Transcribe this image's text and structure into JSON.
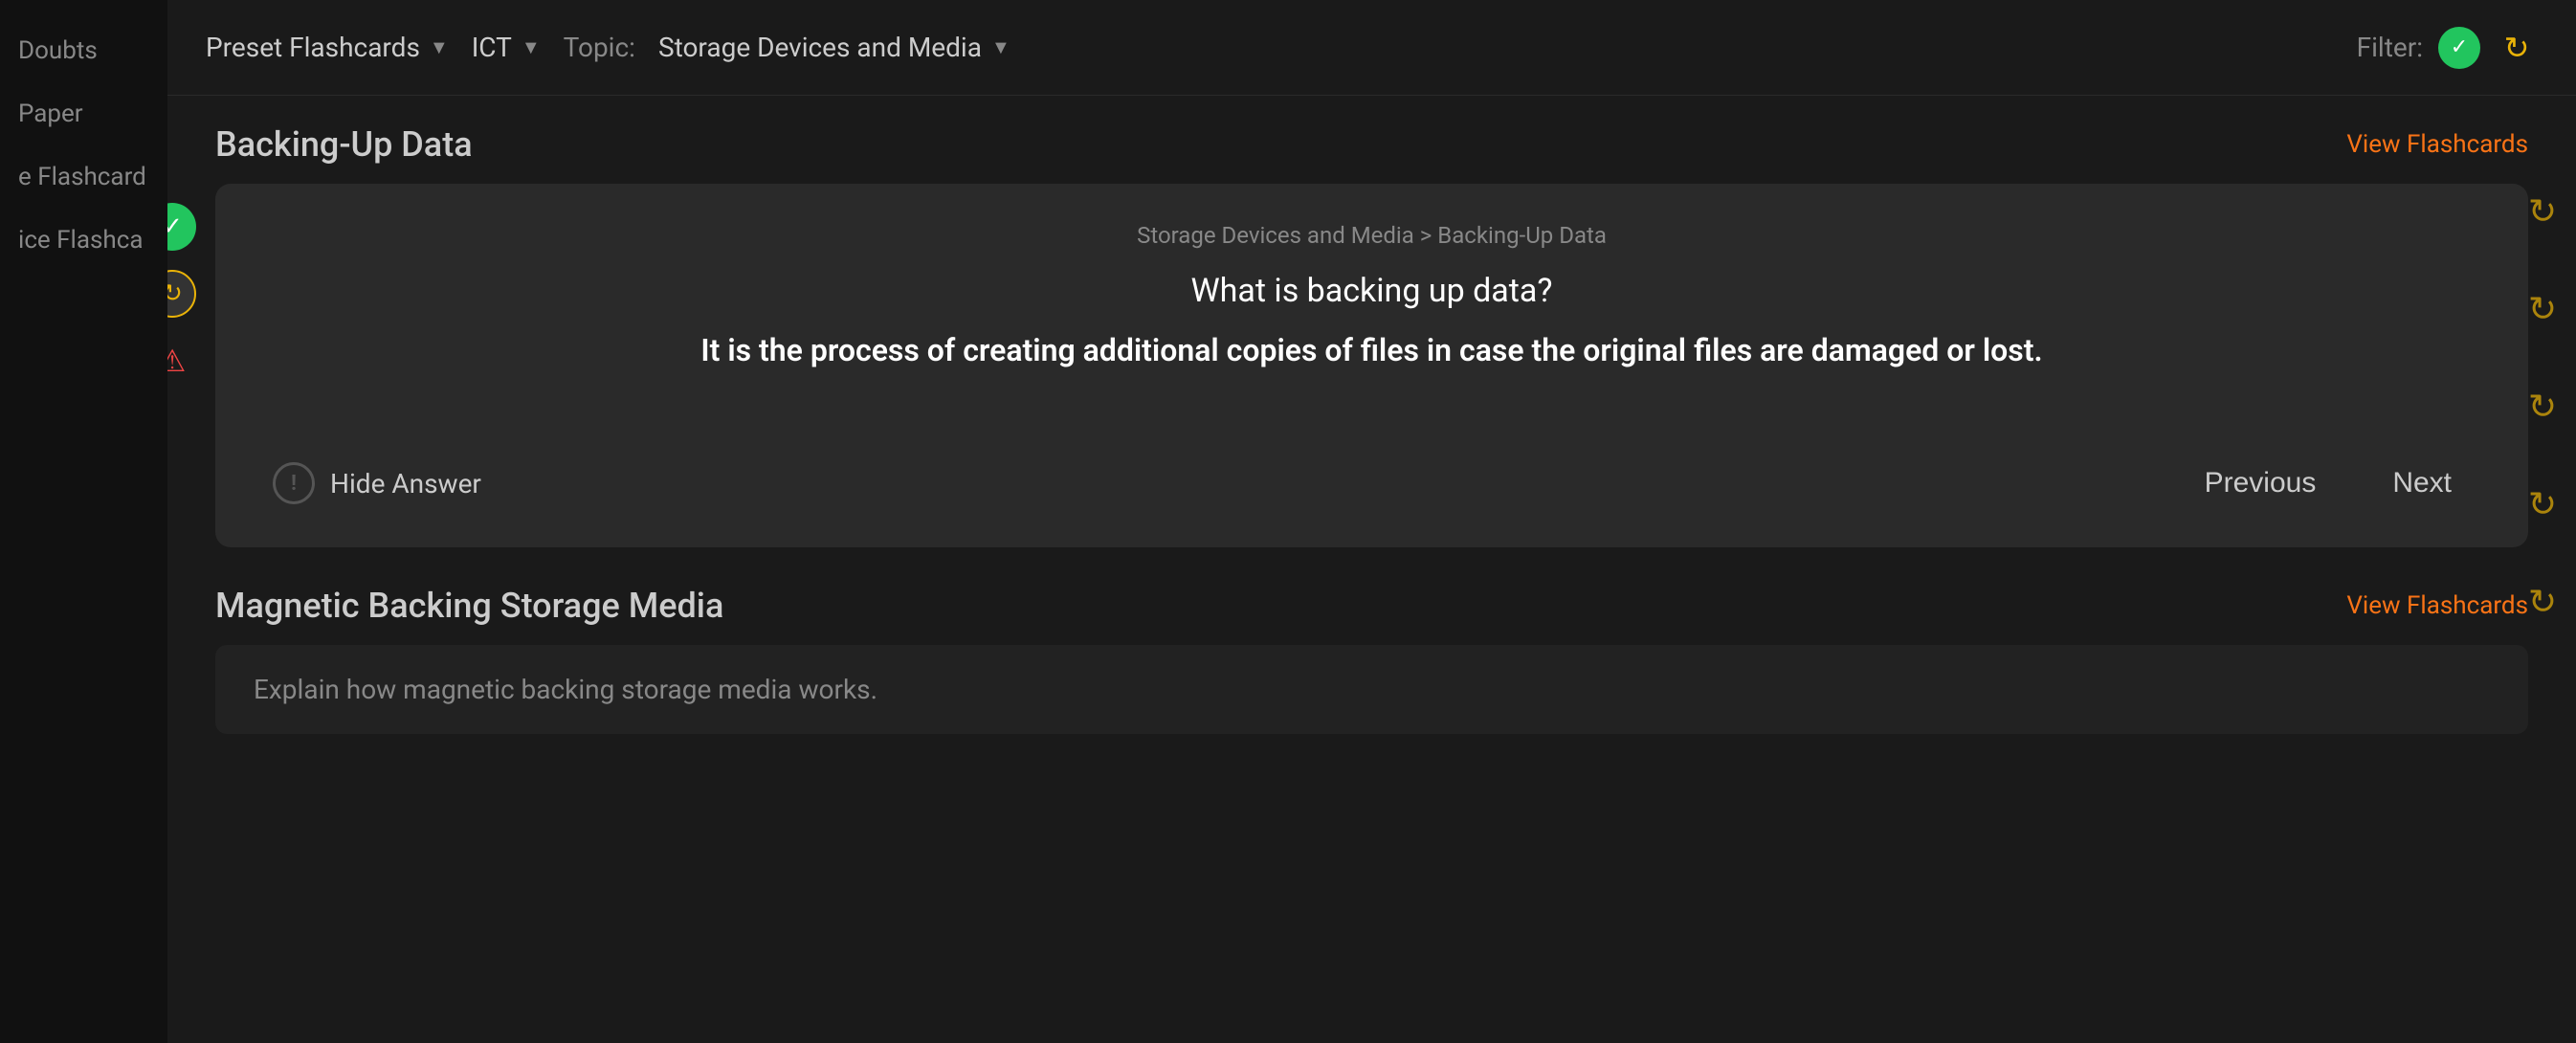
{
  "sidebar": {
    "items": [
      {
        "label": "Doubts",
        "id": "doubts"
      },
      {
        "label": "Paper",
        "id": "paper"
      },
      {
        "label": "e Flashcard",
        "id": "e-flashcard"
      },
      {
        "label": "ice Flashca",
        "id": "practice-flashcard"
      }
    ]
  },
  "topbar": {
    "preset_flashcards_label": "Preset Flashcards",
    "ict_label": "ICT",
    "topic_label": "Topic:",
    "storage_devices_label": "Storage Devices and Media",
    "filter_label": "Filter:",
    "arrow_icon": "▼"
  },
  "section1": {
    "title": "Backing-Up Data",
    "view_flashcards": "View Flashcards"
  },
  "flashcard": {
    "breadcrumb": "Storage Devices and Media > Backing-Up Data",
    "question": "What is backing up data?",
    "answer": "It is the process of creating additional copies of files in case the original files are damaged or lost.",
    "hide_answer_label": "Hide Answer",
    "previous_label": "Previous",
    "next_label": "Next"
  },
  "section2": {
    "title": "Magnetic Backing Storage Media",
    "view_flashcards": "View Flashcards",
    "card_text": "Explain how magnetic backing storage media works."
  },
  "icons": {
    "green_check": "✓",
    "yellow_refresh": "↻",
    "red_warning": "⚠",
    "exclamation": "!",
    "refresh": "↻"
  },
  "colors": {
    "accent_orange": "#f97316",
    "accent_green": "#22c55e",
    "accent_yellow": "#eab308",
    "accent_red": "#ef4444",
    "bg_dark": "#1a1a1a",
    "bg_card": "#2a2a2a"
  }
}
